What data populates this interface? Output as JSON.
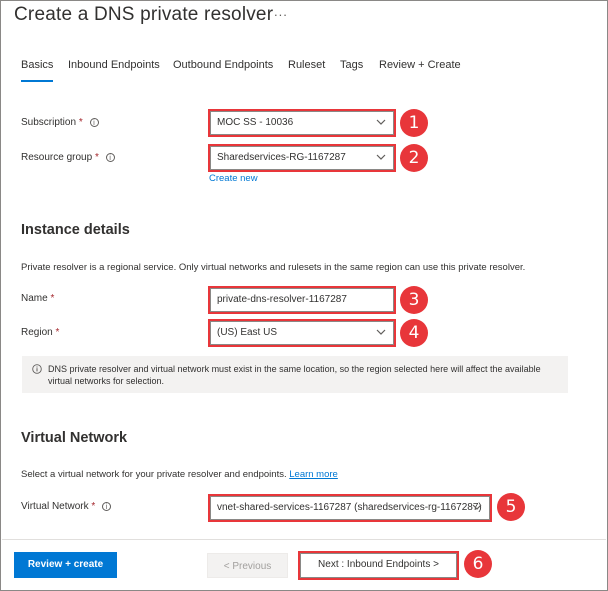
{
  "page": {
    "title": "Create a DNS private resolver",
    "more_label": "..."
  },
  "tabs": [
    {
      "label": "Basics",
      "active": true
    },
    {
      "label": "Inbound Endpoints"
    },
    {
      "label": "Outbound Endpoints"
    },
    {
      "label": "Ruleset"
    },
    {
      "label": "Tags"
    },
    {
      "label": "Review + Create"
    }
  ],
  "project": {
    "subscription": {
      "label": "Subscription",
      "required": "*",
      "info": "i",
      "value": "MOC SS - 10036",
      "callout": "1"
    },
    "resource_group": {
      "label": "Resource group",
      "required": "*",
      "info": "i",
      "value": "Sharedservices-RG-1167287",
      "callout": "2",
      "create_new": "Create new"
    }
  },
  "instance": {
    "heading": "Instance details",
    "description": "Private resolver is a regional service. Only virtual networks and rulesets in the same region can use this private resolver.",
    "name": {
      "label": "Name",
      "required": "*",
      "value": "private-dns-resolver-1167287",
      "callout": "3"
    },
    "region": {
      "label": "Region",
      "required": "*",
      "value": "(US) East US",
      "callout": "4"
    },
    "notice": "DNS private resolver and virtual network must exist in the same location, so the region selected here will affect the available virtual networks for selection."
  },
  "network": {
    "heading": "Virtual Network",
    "description": "Select a virtual network for your private resolver and endpoints.",
    "learn_more": "Learn more",
    "vnet": {
      "label": "Virtual Network",
      "required": "*",
      "info": "i",
      "value": "vnet-shared-services-1167287 (sharedservices-rg-1167287)",
      "callout": "5"
    }
  },
  "footer": {
    "review_create": "Review + create",
    "previous": "< Previous",
    "next": "Next : Inbound Endpoints >",
    "callout": "6"
  },
  "colors": {
    "accent": "#0078d4",
    "highlight": "#e8363a",
    "required": "#a4262c"
  }
}
